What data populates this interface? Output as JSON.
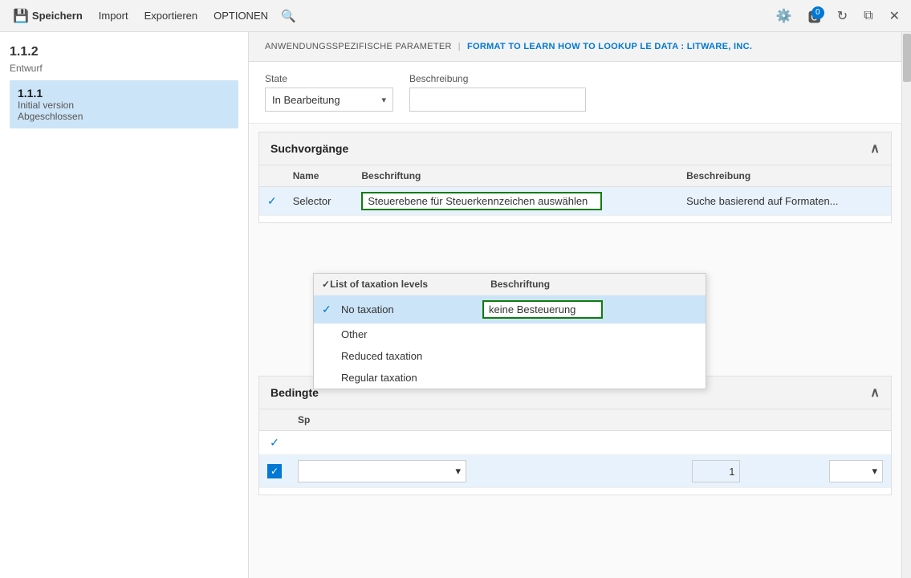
{
  "toolbar": {
    "save_label": "Speichern",
    "import_label": "Import",
    "export_label": "Exportieren",
    "options_label": "OPTIONEN",
    "badge_count": "0"
  },
  "sidebar": {
    "version_label": "1.1.2",
    "draft_label": "Entwurf",
    "item": {
      "version": "1.1.1",
      "sub1": "Initial version",
      "sub2": "Abgeschlossen"
    }
  },
  "breadcrumb": {
    "part1": "ANWENDUNGSSPEZIFISCHE PARAMETER",
    "separator": "|",
    "part2": "FORMAT TO LEARN HOW TO LOOKUP LE DATA : LITWARE, INC."
  },
  "form": {
    "state_label": "State",
    "state_value": "In Bearbeitung",
    "beschreibung_label": "Beschreibung",
    "beschreibung_placeholder": ""
  },
  "suchvorgaenge": {
    "section_title": "Suchvorgänge",
    "col_check": "",
    "col_name": "Name",
    "col_beschriftung": "Beschriftung",
    "col_beschreibung": "Beschreibung",
    "row": {
      "name": "Selector",
      "beschriftung": "Steuerebene für Steuerkennzeichen auswählen",
      "beschreibung": "Suche basierend auf Formaten..."
    }
  },
  "dropdown": {
    "col_list": "List of taxation levels",
    "col_beschriftung": "Beschriftung",
    "items": [
      {
        "id": "no-taxation",
        "name": "No taxation",
        "label": "keine Besteuerung",
        "selected": true
      },
      {
        "id": "other",
        "name": "Other",
        "label": ""
      },
      {
        "id": "reduced",
        "name": "Reduced taxation",
        "label": ""
      },
      {
        "id": "regular",
        "name": "Regular taxation",
        "label": ""
      }
    ]
  },
  "bedingungen": {
    "section_title": "Bedingte",
    "col_check": "",
    "row_check_label": "",
    "row_number": "1",
    "row_select_placeholder": ""
  }
}
